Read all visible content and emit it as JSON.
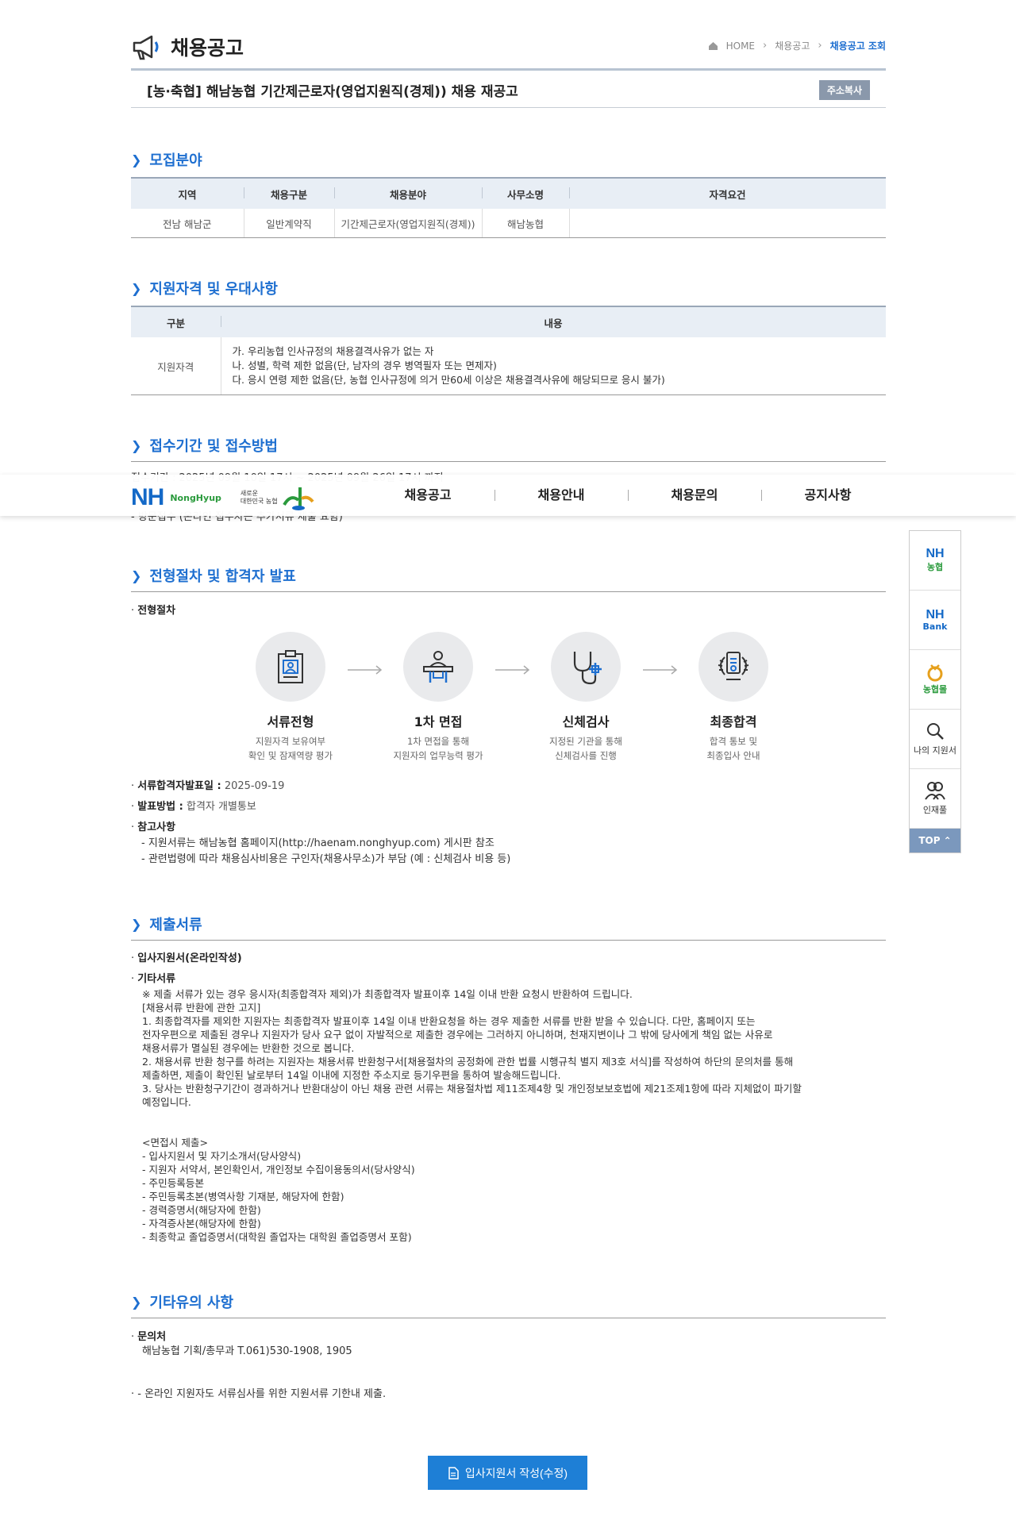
{
  "header": {
    "title": "채용공고",
    "breadcrumb": [
      "HOME",
      "채용공고",
      "채용공고 조회"
    ]
  },
  "post": {
    "title": "[농·축협] 해남농협 기간제근로자(영업지원직(경제)) 채용 재공고",
    "copy_button": "주소복사"
  },
  "sections": {
    "recruit": "모집분야",
    "qualification": "지원자격 및 우대사항",
    "reception": "접수기간 및 접수방법",
    "process": "전형절차 및 합격자 발표",
    "documents": "제출서류",
    "etc": "기타유의 사항"
  },
  "recruit_table": {
    "headers": [
      "지역",
      "채용구분",
      "채용분야",
      "사무소명",
      "자격요건"
    ],
    "row": [
      "전남 해남군",
      "일반계약직",
      "기간제근로자(영업지원직(경제))",
      "해남농협",
      ""
    ]
  },
  "qual_table": {
    "headers": [
      "구분",
      "내용"
    ],
    "label": "지원자격",
    "lines": [
      "가. 우리농협 인사규정의 채용결격사유가 없는 자",
      "나. 성별, 학력 제한 없음(단, 남자의 경우 병역필자 또는 면제자)",
      "다. 응시 연령 제한 없음(단, 농협 인사규정에 의거 만60세 이상은 채용결격사유에 해당되므로 응시 불가)"
    ]
  },
  "reception": {
    "line1": "접수기간 : 2025년 09월 10일 17시 ~ 2025년 09월 26일 17시 까지",
    "line2": "- 방문접수 (온라인 접수자는 추가서류 제출 요함)"
  },
  "process": {
    "sub_label": "전형절차",
    "steps": [
      {
        "name": "서류전형",
        "desc": "지원자격 보유여부\n확인 및 잠재역량 평가",
        "icon": "resume-icon"
      },
      {
        "name": "1차 면접",
        "desc": "1차 면접을 통해\n지원자의 업무능력 평가",
        "icon": "interview-icon"
      },
      {
        "name": "신체검사",
        "desc": "지정된 기관을 통해\n신체검사를 진행",
        "icon": "stethoscope-icon"
      },
      {
        "name": "최종합격",
        "desc": "합격 통보 및\n최종입사 안내",
        "icon": "award-icon"
      }
    ],
    "announce_label": "서류합격자발표일 :",
    "announce_value": "2025-09-19",
    "method_label": "발표방법 :",
    "method_value": "합격자 개별통보",
    "ref_label": "참고사항",
    "ref_lines": [
      "- 지원서류는 해남농협 홈페이지(http://haenam.nonghyup.com) 게시판 참조",
      "- 관련법령에 따라 채용심사비용은 구인자(채용사무소)가 부담 (예 : 신체검사 비용 등)"
    ]
  },
  "documents": {
    "item1": "입사지원서(온라인작성)",
    "item2": "기타서류",
    "body": "※ 제출 서류가 있는 경우 응시자(최종합격자 제외)가 최종합격자 발표이후 14일 이내 반환 요청시 반환하여 드립니다.\n[채용서류 반환에 관한 고지]\n 1. 최종합격자를 제외한 지원자는 최종합격자 발표이후 14일 이내 반환요청을 하는 경우 제출한 서류를 반환 받을 수 있습니다. 다만, 홈페이지 또는\n전자우편으로 제출된 경우나 지원자가 당사 요구 없이 자발적으로 제출한 경우에는 그러하지 아니하며, 천재지변이나 그 밖에 당사에게 책임 없는 사유로\n채용서류가 멸실된 경우에는 반환한 것으로 봅니다.\n 2. 채용서류 반환 청구를 하려는 지원자는 채용서류 반환청구서[채용절차의 공정화에 관한 법률 시행규칙 별지 제3호 서식]를 작성하여 하단의 문의처를 통해\n제출하면, 제출이 확인된 날로부터 14일 이내에 지정한 주소지로 등기우편을 통하여 발송해드립니다.\n 3. 당사는 반환청구기간이 경과하거나 반환대상이 아닌 채용 관련 서류는 채용절차법 제11조제4항 및 개인정보보호법에 제21조제1항에 따라 지체없이 파기할\n예정입니다.\n\n\n <면접시 제출>\n - 입사지원서 및 자기소개서(당사양식)\n - 지원자 서약서, 본인확인서, 개인정보 수집이용동의서(당사양식)\n - 주민등록등본\n- 주민등록초본(병역사항 기재분, 해당자에 한함)\n- 경력증명서(해당자에 한함)\n- 자격증사본(해당자에 한함)\n- 최종학교 졸업증명서(대학원 졸업자는 대학원 졸업증명서 포함)"
  },
  "etc": {
    "contact_label": "문의처",
    "contact_value": "해남농협 기획/총무과    T.061)530-1908, 1905",
    "note": "- 온라인 지원자도 서류심사를 위한 지원서류 기한내 제출."
  },
  "navbar": {
    "logo": "NH",
    "logo_sub": "NongHyup",
    "logo_new": "새로운\n대한민국 농협",
    "items": [
      "채용공고",
      "채용안내",
      "채용문의",
      "공지사항"
    ]
  },
  "quick_menu": {
    "items": [
      {
        "top": "NH",
        "bottom": "농협"
      },
      {
        "top": "NH",
        "bottom": "Bank"
      },
      {
        "top": "",
        "bottom": "농협몰"
      },
      {
        "top": "",
        "bottom": "나의 지원서"
      },
      {
        "top": "",
        "bottom": "인재풀"
      }
    ],
    "top_label": "TOP"
  },
  "apply_button": "입사지원서 작성(수정)",
  "colors": {
    "accent": "#1e6fd0",
    "button": "#1e7fd6",
    "nh_blue": "#1469c7",
    "nh_green": "#2a9a3c"
  }
}
